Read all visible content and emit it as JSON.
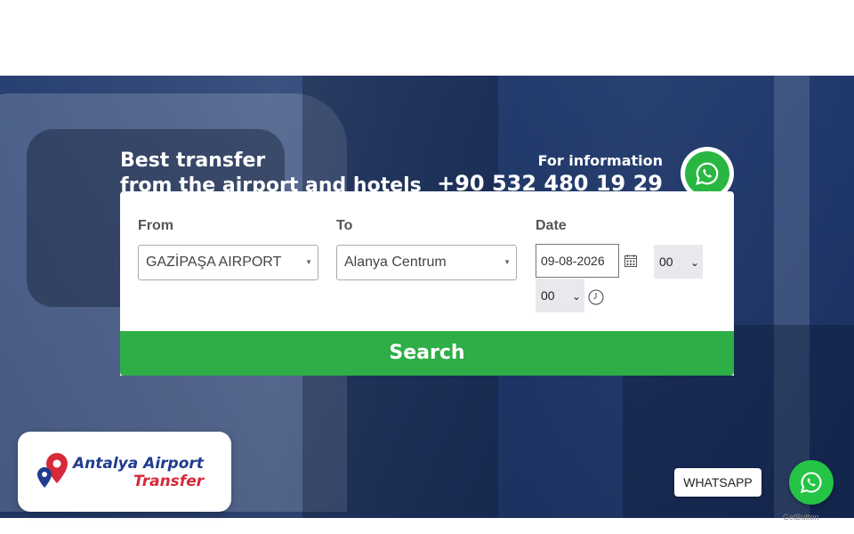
{
  "hero": {
    "headline_line1": "Best transfer",
    "headline_line2": "from the airport and hotels",
    "info_label": "For information",
    "phone": "+90 532 480 19 29",
    "whatsapp_icon": "whatsapp-icon"
  },
  "form": {
    "from_label": "From",
    "from_value": "GAZİPAŞA AIRPORT",
    "to_label": "To",
    "to_value": "Alanya Centrum",
    "date_label": "Date",
    "date_value": "09-08-2026",
    "hour_value": "00",
    "minute_value": "00",
    "search_label": "Search"
  },
  "logo": {
    "line1": "Antalya Airport",
    "line2": "Transfer"
  },
  "whatsapp_widget": {
    "label": "WHATSAPP",
    "credit": "GetButton"
  },
  "colors": {
    "search_button": "#2eae47",
    "whatsapp_green": "#25c444",
    "logo_blue": "#1f3c8f",
    "logo_red": "#d62a3a"
  }
}
